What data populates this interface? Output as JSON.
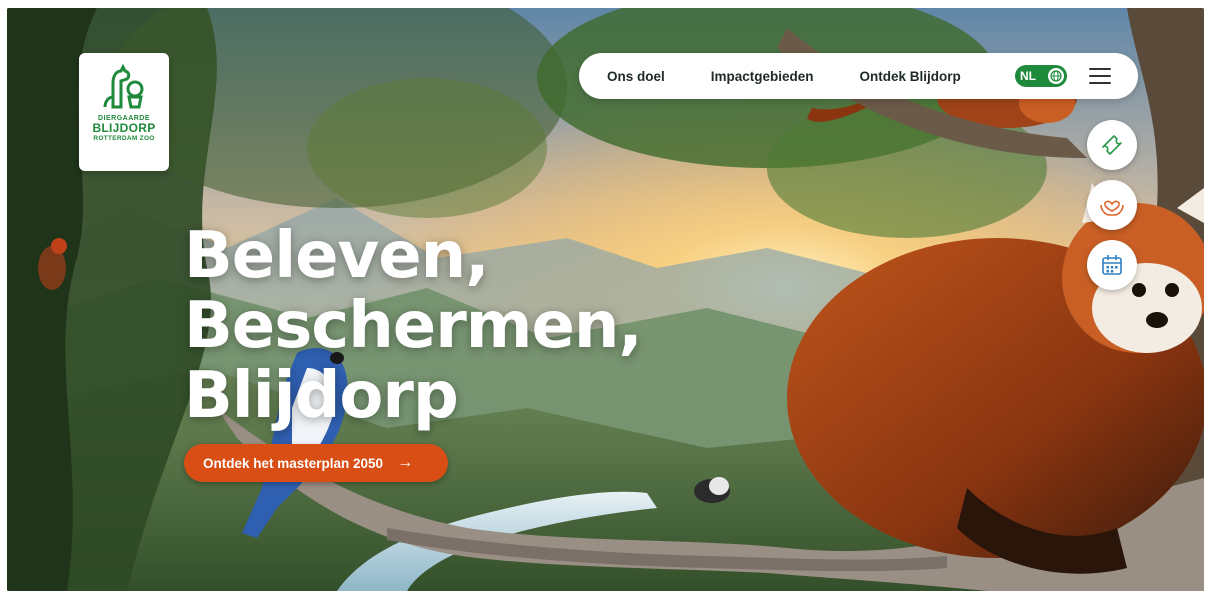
{
  "logo": {
    "line1": "DIERGAARDE",
    "line2": "BLIJDORP",
    "line3": "ROTTERDAM ZOO"
  },
  "nav": {
    "links": [
      "Ons doel",
      "Impactgebieden",
      "Ontdek Blijdorp"
    ],
    "language": "NL",
    "icons": {
      "language": "globe-icon",
      "menu": "hamburger-menu-icon"
    }
  },
  "side_actions": [
    {
      "icon": "ticket-icon"
    },
    {
      "icon": "heart-hands-icon"
    },
    {
      "icon": "calendar-icon"
    }
  ],
  "hero": {
    "headline": [
      "Beleven,",
      "Beschermen,",
      "Blijdorp"
    ],
    "cta_label": "Ontdek het masterplan 2050",
    "cta_arrow": "→"
  },
  "colors": {
    "brand_green": "#1f8a3b",
    "cta_orange": "#d84e14",
    "side_icon_green": "#2a9a4a",
    "side_icon_orange": "#e0652a",
    "side_icon_blue": "#2f7fc1"
  }
}
